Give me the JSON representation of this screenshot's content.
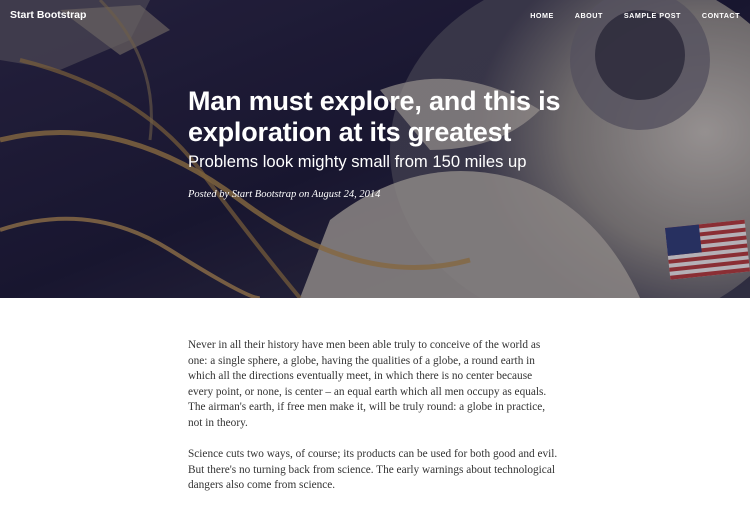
{
  "navbar": {
    "brand": "Start Bootstrap",
    "links": [
      "HOME",
      "ABOUT",
      "SAMPLE POST",
      "CONTACT"
    ]
  },
  "header": {
    "title": "Man must explore, and this is exploration at its greatest",
    "subtitle": "Problems look mighty small from 150 miles up",
    "meta_prefix": "Posted by",
    "author": "Start Bootstrap",
    "meta_middle": "on",
    "date": "August 24, 2014"
  },
  "article": {
    "paragraphs": [
      "Never in all their history have men been able truly to conceive of the world as one: a single sphere, a globe, having the qualities of a globe, a round earth in which all the directions eventually meet, in which there is no center because every point, or none, is center – an equal earth which all men occupy as equals. The airman's earth, if free men make it, will be truly round: a globe in practice, not in theory.",
      "Science cuts two ways, of course; its products can be used for both good and evil. But there's no turning back from science. The early warnings about technological dangers also come from science."
    ]
  },
  "colors": {
    "hero_tint": "#1c1a33",
    "text": "#333333"
  }
}
